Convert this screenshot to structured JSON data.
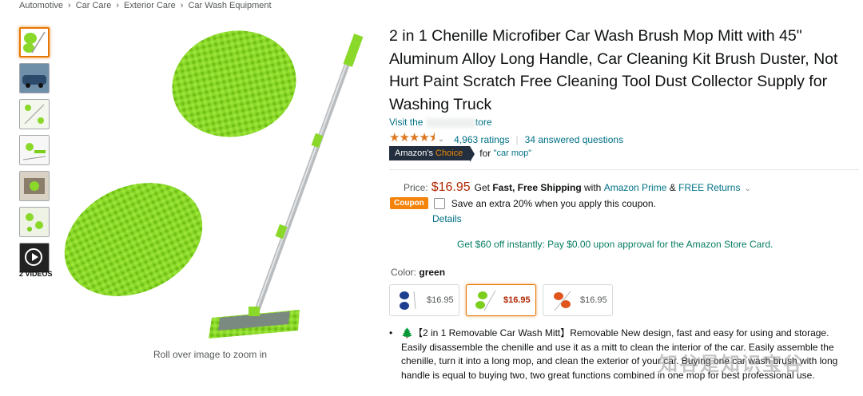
{
  "breadcrumb": [
    "Automotive",
    "Car Care",
    "Exterior Care",
    "Car Wash Equipment"
  ],
  "breadcrumb_sep": "›",
  "gallery": {
    "videos_label": "2 VIDEOS",
    "zoom_hint": "Roll over image to zoom in"
  },
  "product": {
    "title": "2 in 1 Chenille Microfiber Car Wash Brush Mop Mitt with 45\" Aluminum Alloy Long Handle, Car Cleaning Kit Brush Duster, Not Hurt Paint Scratch Free Cleaning Tool Dust Collector Supply for Washing Truck",
    "store_prefix": "Visit the",
    "store_suffix": "tore",
    "stars": "★★★★⯨",
    "rating_count": "4,963 ratings",
    "answered": "34 answered questions",
    "choice_amazon": "Amazon's",
    "choice_word": "Choice",
    "choice_for": "for",
    "choice_query": "\"car mop\""
  },
  "pricing": {
    "label": "Price:",
    "price": "$16.95",
    "get": "Get",
    "shipping": "Fast, Free Shipping",
    "with": "with",
    "prime": "Amazon Prime",
    "amp": "&",
    "returns": "FREE Returns",
    "coupon_badge": "Coupon",
    "coupon_text": "Save an extra 20% when you apply this coupon.",
    "details": "Details",
    "card_offer": "Get $60 off instantly: Pay $0.00 upon approval for the Amazon Store Card."
  },
  "color": {
    "label": "Color:",
    "selected": "green",
    "options": [
      {
        "price": "$16.95",
        "color": "#1d3f8f"
      },
      {
        "price": "$16.95",
        "color": "#7ccf1c"
      },
      {
        "price": "$16.95",
        "color": "#e0551c"
      }
    ]
  },
  "bullets": [
    {
      "icon": "🌲",
      "text": "【2 in 1 Removable Car Wash Mitt】Removable New design, fast and easy for using and storage. Easily disassemble the chenille and use it as a mitt to clean the interior of the car. Easily assemble the chenille, turn it into a long mop, and clean the exterior of your car. Buying one car wash brush with long handle is equal to buying two, two great functions combined in one mop for best professional use."
    }
  ],
  "watermark": "知谷是知识宝谷",
  "colors": {
    "link": "#007185",
    "price": "#b12704",
    "accent": "#e77600",
    "star": "#de7921"
  }
}
